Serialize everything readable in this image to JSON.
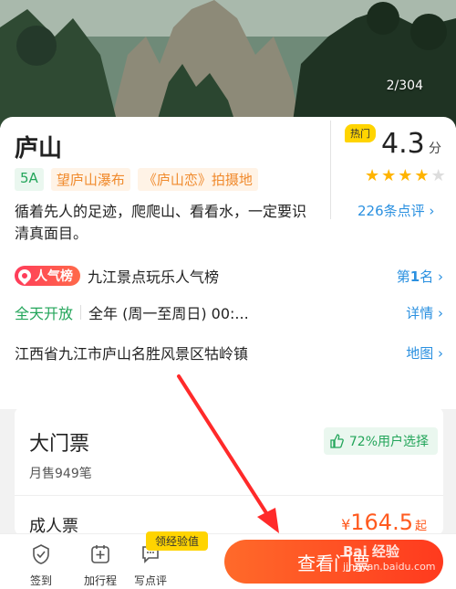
{
  "hero": {
    "counter": "2/304"
  },
  "attraction": {
    "title": "庐山",
    "tags": [
      "5A",
      "望庐山瀑布",
      "《庐山恋》拍摄地"
    ],
    "description": "循着先人的足迹，爬爬山、看看水，一定要识清真面目。"
  },
  "rating": {
    "badge": "热门",
    "score": "4.3",
    "unit": "分",
    "stars": 4,
    "reviews_link": "226条点评 ›"
  },
  "rows": {
    "rank_badge": "人气榜",
    "rank_text": "九江景点玩乐人气榜",
    "rank_right_prefix": "第",
    "rank_right_num": "1",
    "rank_right_suffix": "名 ›",
    "open_status": "全天开放",
    "open_hours": "全年 (周一至周日) 00:...",
    "open_link": "详情 ›",
    "address": "江西省九江市庐山名胜风景区牯岭镇",
    "map_link": "地图 ›"
  },
  "ticket": {
    "title": "大门票",
    "monthly_sales": "月售949笔",
    "pick_rate": "72%用户选择",
    "adult_label": "成人票",
    "currency": "¥",
    "price": "164.5",
    "price_suffix": "起"
  },
  "bottom_bar": {
    "checkin": "签到",
    "add_trip": "加行程",
    "write_review": "写点评",
    "exp_badge": "领经验值",
    "cta": "查看门票"
  },
  "watermark": {
    "brand": "Bai 经验",
    "url": "jingyan.baidu.com"
  },
  "colors": {
    "accent_blue": "#2a90e0",
    "green": "#23a55a",
    "orange": "#ff5a1f",
    "yellow": "#ffd400",
    "cta": "#ff3a1e"
  }
}
